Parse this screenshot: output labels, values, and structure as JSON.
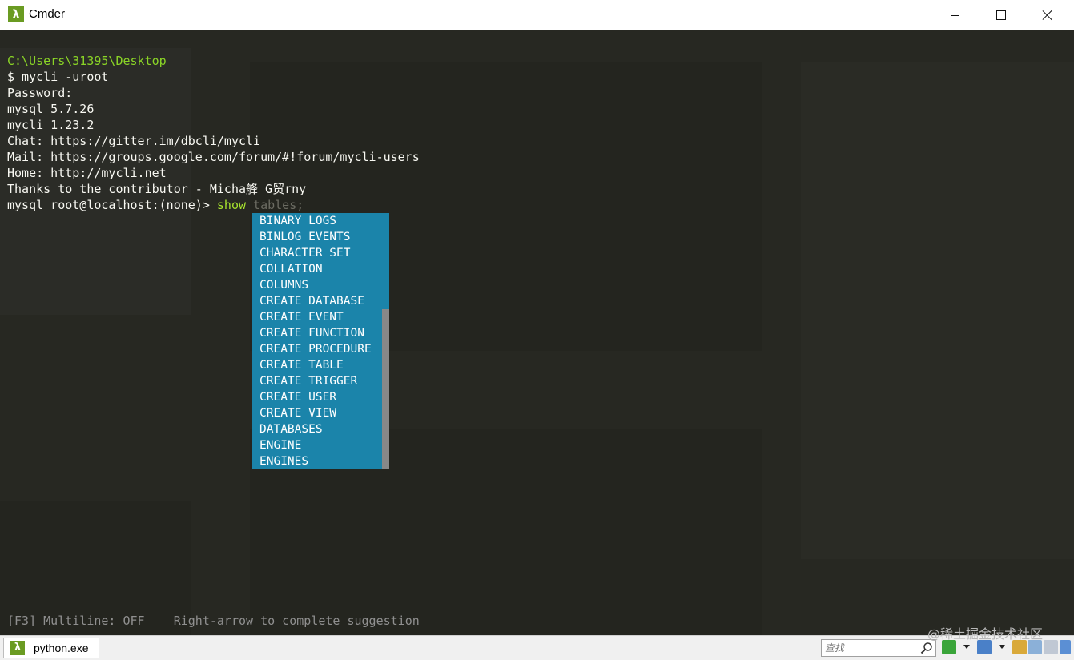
{
  "window": {
    "title": "Cmder",
    "app_icon": "lambda-icon",
    "app_icon_glyph": "λ"
  },
  "terminal": {
    "lines": [
      "C:\\Users\\31395\\Desktop",
      "$ mycli -uroot",
      "Password:",
      "mysql 5.7.26",
      "mycli 1.23.2",
      "Chat: https://gitter.im/dbcli/mycli",
      "Mail: https://groups.google.com/forum/#!forum/mycli-users",
      "Home: http://mycli.net",
      "Thanks to the contributor - Micha艂 G贸rny"
    ],
    "prompt": "mysql root@localhost:(none)> ",
    "typed_command": "show",
    "suggestion_ghost": " tables;",
    "completion_menu": [
      "BINARY LOGS",
      "BINLOG EVENTS",
      "CHARACTER SET",
      "COLLATION",
      "COLUMNS",
      "CREATE DATABASE",
      "CREATE EVENT",
      "CREATE FUNCTION",
      "CREATE PROCEDURE",
      "CREATE TABLE",
      "CREATE TRIGGER",
      "CREATE USER",
      "CREATE VIEW",
      "DATABASES",
      "ENGINE",
      "ENGINES"
    ],
    "bottom_toolbar": "[F3] Multiline: OFF    Right-arrow to complete suggestion"
  },
  "taskbar": {
    "task_label": "python.exe",
    "search_placeholder": "查找",
    "watermark": "@稀土掘金技术社区"
  },
  "colors": {
    "terminal_bg": "#272822",
    "path_green": "#8ad426",
    "menu_bg": "#1b84aa",
    "text": "#f8f8f2"
  }
}
